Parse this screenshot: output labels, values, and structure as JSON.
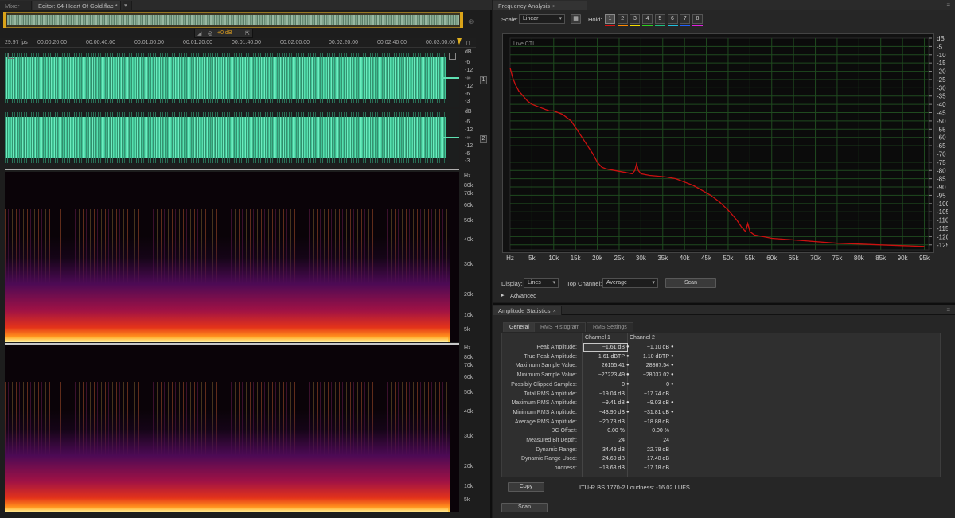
{
  "editor": {
    "tabs": [
      {
        "label": "Mixer"
      },
      {
        "label": "Editor: 04-Heart Of Gold.flac *"
      }
    ],
    "hud_volume": "+0 dB",
    "fps": "29.97 fps",
    "timecodes": [
      "00:00:20:00",
      "00:00:40:00",
      "00:01:00:00",
      "00:01:20:00",
      "00:01:40:00",
      "00:02:00:00",
      "00:02:20:00",
      "00:02:40:00",
      "00:03:00:00"
    ],
    "channels": [
      {
        "number": "1",
        "db_unit": "dB",
        "db_ticks": [
          "-6",
          "-12",
          "-∞",
          "-12",
          "-6",
          "-3"
        ]
      },
      {
        "number": "2",
        "db_unit": "dB",
        "db_ticks": [
          "-6",
          "-12",
          "-∞",
          "-12",
          "-6",
          "-3"
        ]
      }
    ],
    "spectral": {
      "unit": "Hz",
      "freq_ticks": [
        "80k",
        "70k",
        "60k",
        "50k",
        "40k",
        "30k",
        "20k",
        "10k",
        "5k"
      ]
    }
  },
  "frequency_analysis": {
    "tab_label": "Frequency Analysis",
    "scale_label": "Scale:",
    "scale_value": "Linear",
    "hold_label": "Hold:",
    "hold_slots": [
      {
        "label": "1",
        "color": "#e01010"
      },
      {
        "label": "2",
        "color": "#ff8a00"
      },
      {
        "label": "3",
        "color": "#f5e000"
      },
      {
        "label": "4",
        "color": "#2fd020"
      },
      {
        "label": "5",
        "color": "#20c080"
      },
      {
        "label": "6",
        "color": "#20c0e0"
      },
      {
        "label": "7",
        "color": "#2060ff"
      },
      {
        "label": "8",
        "color": "#e020e0"
      }
    ],
    "live_label": "Live CTI",
    "display_label": "Display:",
    "display_value": "Lines",
    "top_channel_label": "Top Channel:",
    "top_channel_value": "Average",
    "scan_label": "Scan",
    "advanced_label": "Advanced",
    "trace_color": "#cc1010"
  },
  "chart_data": {
    "type": "line",
    "xlabel": "",
    "ylabel": "",
    "x_unit": "Hz",
    "y_unit": "dB",
    "xlim": [
      0,
      96000
    ],
    "ylim": [
      -128,
      0
    ],
    "x_ticks": [
      "Hz",
      "5k",
      "10k",
      "15k",
      "20k",
      "25k",
      "30k",
      "35k",
      "40k",
      "45k",
      "50k",
      "55k",
      "60k",
      "65k",
      "70k",
      "75k",
      "80k",
      "85k",
      "90k",
      "95k"
    ],
    "y_ticks": [
      "dB",
      "-5",
      "-10",
      "-15",
      "-20",
      "-25",
      "-30",
      "-35",
      "-40",
      "-45",
      "-50",
      "-55",
      "-60",
      "-65",
      "-70",
      "-75",
      "-80",
      "-85",
      "-90",
      "-95",
      "-100",
      "-105",
      "-110",
      "-115",
      "-120",
      "-125"
    ],
    "grid": true,
    "series": [
      {
        "x": [
          0,
          200,
          600,
          1200,
          2000,
          3000,
          4000,
          5000,
          6000,
          7000,
          8000,
          9000,
          10000,
          11000,
          12000,
          13000,
          14000,
          15000,
          16000,
          17000,
          18000,
          19000,
          20000,
          21000,
          22000,
          24000,
          26000,
          28000,
          28600,
          29000,
          29400,
          30000,
          32000,
          34000,
          36000,
          38000,
          40000,
          42000,
          44000,
          46000,
          48000,
          50000,
          52000,
          53000,
          54000,
          54500,
          55000,
          56000,
          58000,
          60000,
          65000,
          70000,
          75000,
          80000,
          85000,
          90000,
          95000
        ],
        "y": [
          -18,
          -20,
          -24,
          -28,
          -32,
          -35,
          -38,
          -40,
          -41,
          -42,
          -43,
          -44,
          -44,
          -45,
          -46,
          -48,
          -50,
          -54,
          -58,
          -62,
          -66,
          -70,
          -75,
          -78,
          -79,
          -80,
          -81,
          -82,
          -80,
          -76,
          -80,
          -82,
          -83,
          -83.5,
          -84,
          -85,
          -87,
          -89,
          -92,
          -95,
          -99,
          -104,
          -110,
          -114,
          -117,
          -112,
          -117,
          -119,
          -120,
          -121,
          -122,
          -123,
          -124,
          -124.5,
          -125,
          -125.5,
          -126
        ]
      }
    ]
  },
  "amplitude_statistics": {
    "tab_label": "Amplitude Statistics",
    "subtabs": [
      {
        "label": "General"
      },
      {
        "label": "RMS Histogram"
      },
      {
        "label": "RMS Settings"
      }
    ],
    "col_headers": [
      "Channel 1",
      "Channel 2"
    ],
    "rows": [
      {
        "label": "Peak Amplitude:",
        "c1": "−1.61 dB",
        "c2": "−1.10 dB",
        "pin": true
      },
      {
        "label": "True Peak Amplitude:",
        "c1": "−1.61 dBTP",
        "c2": "−1.10 dBTP",
        "pin": true
      },
      {
        "label": "Maximum Sample Value:",
        "c1": "26155.41",
        "c2": "28867.54",
        "pin": true
      },
      {
        "label": "Minimum Sample Value:",
        "c1": "−27223.49",
        "c2": "−28037.02",
        "pin": true
      },
      {
        "label": "Possibly Clipped Samples:",
        "c1": "0",
        "c2": "0",
        "pin": true
      },
      {
        "label": "Total RMS Amplitude:",
        "c1": "−19.04 dB",
        "c2": "−17.74 dB",
        "pin": false
      },
      {
        "label": "Maximum RMS Amplitude:",
        "c1": "−9.41 dB",
        "c2": "−9.03 dB",
        "pin": true
      },
      {
        "label": "Minimum RMS Amplitude:",
        "c1": "−43.90 dB",
        "c2": "−31.81 dB",
        "pin": true
      },
      {
        "label": "Average RMS Amplitude:",
        "c1": "−20.78 dB",
        "c2": "−18.88 dB",
        "pin": false
      },
      {
        "label": "DC Offset:",
        "c1": "0.00 %",
        "c2": "0.00 %",
        "pin": false
      },
      {
        "label": "Measured Bit Depth:",
        "c1": "24",
        "c2": "24",
        "pin": false
      },
      {
        "label": "Dynamic Range:",
        "c1": "34.49 dB",
        "c2": "22.78 dB",
        "pin": false
      },
      {
        "label": "Dynamic Range Used:",
        "c1": "24.60 dB",
        "c2": "17.40 dB",
        "pin": false
      },
      {
        "label": "Loudness:",
        "c1": "−18.63 dB",
        "c2": "−17.18 dB",
        "pin": false
      }
    ],
    "copy_label": "Copy",
    "loudness_summary": "ITU-R BS.1770-2 Loudness: -16.02 LUFS",
    "scan_label": "Scan"
  }
}
